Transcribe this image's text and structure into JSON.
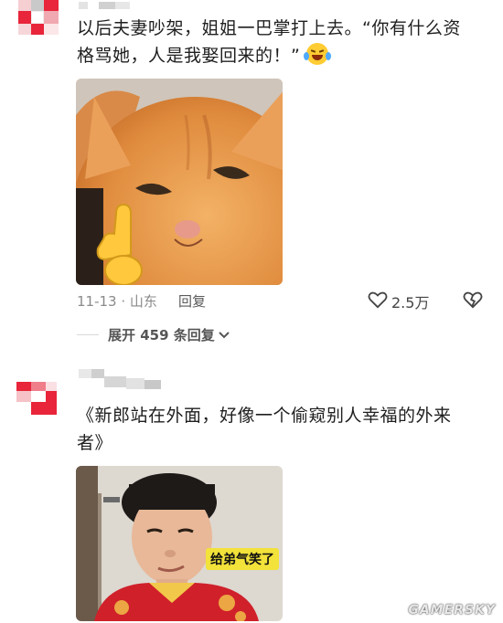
{
  "comment1": {
    "line1": "以后夫妻吵架，姐姐一巴掌打上去。“你有什么资",
    "line2": "格骂她，人是我娶回来的！”",
    "emoji": "crying-laughing-emoji",
    "date_location": "11-13 · 山东",
    "reply_label": "回复",
    "like_count": "2.5万",
    "expand_label": "展开 459 条回复"
  },
  "comment2": {
    "line1": "《新郎站在外面，好像一个偷窥别人幸福的外来",
    "line2": "者》",
    "photo_caption": "给弟气笑了"
  },
  "watermark": "GAMERSKY",
  "colors": {
    "avatar_red": "#e8253a",
    "caption_yellow": "#f2e23a",
    "cat_orange": "#e59a4e"
  }
}
